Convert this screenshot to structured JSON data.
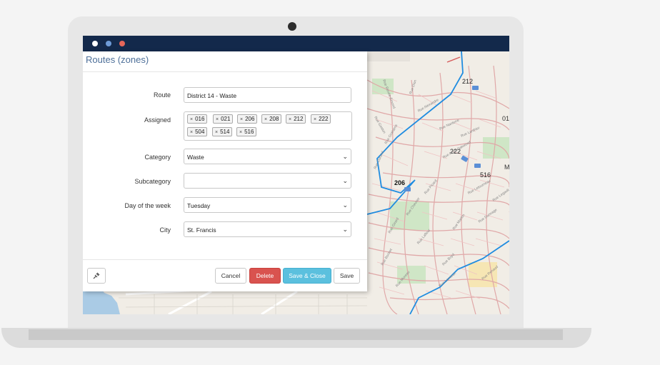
{
  "colors": {
    "titlebar": "#13294b",
    "dot_white": "#ffffff",
    "dot_blue": "#6e9bd7",
    "dot_red": "#e5665a",
    "delete": "#d9534f",
    "save_close": "#5bc0de",
    "zone_line": "#1f8ce0"
  },
  "dialog": {
    "title": "Routes (zones)",
    "fields": {
      "route": {
        "label": "Route",
        "value": "District 14 - Waste"
      },
      "assigned": {
        "label": "Assigned",
        "tags": [
          "016",
          "021",
          "206",
          "208",
          "212",
          "222",
          "504",
          "514",
          "516"
        ]
      },
      "category": {
        "label": "Category",
        "value": "Waste"
      },
      "subcategory": {
        "label": "Subcategory",
        "value": ""
      },
      "day": {
        "label": "Day of the week",
        "value": "Tuesday"
      },
      "city": {
        "label": "City",
        "value": "St. Francis"
      }
    },
    "buttons": {
      "cancel": "Cancel",
      "delete": "Delete",
      "save_close": "Save & Close",
      "save": "Save"
    },
    "tag_remove_glyph": "×",
    "caret_glyph": "⌄"
  },
  "map": {
    "route_labels": [
      "212",
      "222",
      "516",
      "206"
    ],
    "edge_labels": [
      "01",
      "M"
    ],
    "streets": [
      "Rue Renée-Émond",
      "Rue Gaston",
      "Rue Grahams",
      "Rue Durand",
      "Rue Alexandre",
      "Rue Nanterre",
      "Rue Atlas-Oakwood",
      "Rue Chevrier",
      "Rue Lafleur",
      "Rue Boyd",
      "Rue Bonnet",
      "Rue Moreau",
      "Rue Letourneau",
      "Rue Durivage",
      "Rue Lemieux",
      "Rue Marion",
      "Rue Renaud",
      "Rue Girard",
      "Rue Dion",
      "Rue Lanthier",
      "Rue Legault",
      "Rue Picard"
    ]
  }
}
